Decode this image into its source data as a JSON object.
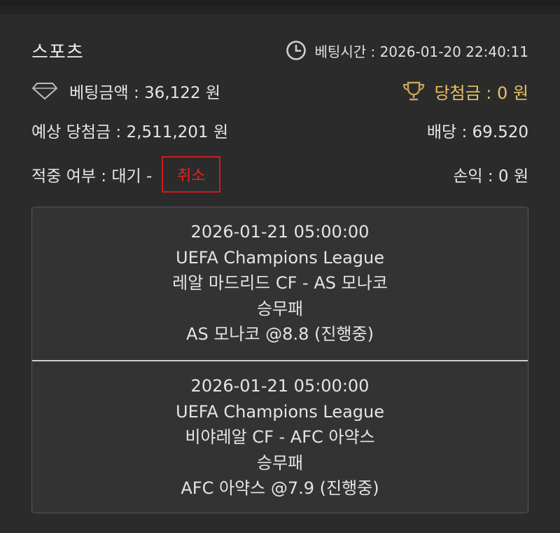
{
  "header": {
    "title": "스포츠",
    "bet_time": "베팅시간 : 2026-01-20 22:40:11"
  },
  "summary": {
    "bet_amount": "베팅금액 : 36,122 원",
    "win_amount": "당첨금 : 0 원",
    "expected_win": "예상 당첨금 : 2,511,201 원",
    "odds": "배당 : 69.520",
    "hit_status": "적중 여부 : 대기 -",
    "cancel_label": "취소",
    "profit": "손익 : 0 원"
  },
  "colors": {
    "background": "#2b2b2b",
    "win_gold": "#e8c262",
    "cancel_red": "#e52424",
    "panel_bg": "#333333"
  },
  "icons": {
    "clock": "clock-icon",
    "diamond": "diamond-icon",
    "trophy": "trophy-icon"
  },
  "matches": [
    {
      "datetime": "2026-01-21 05:00:00",
      "league": "UEFA Champions League",
      "teams": "레알 마드리드 CF - AS 모나코",
      "market": "승무패",
      "pick": "AS 모나코 @8.8 (진행중)"
    },
    {
      "datetime": "2026-01-21 05:00:00",
      "league": "UEFA Champions League",
      "teams": "비야레알 CF - AFC 아약스",
      "market": "승무패",
      "pick": "AFC 아약스 @7.9 (진행중)"
    }
  ]
}
